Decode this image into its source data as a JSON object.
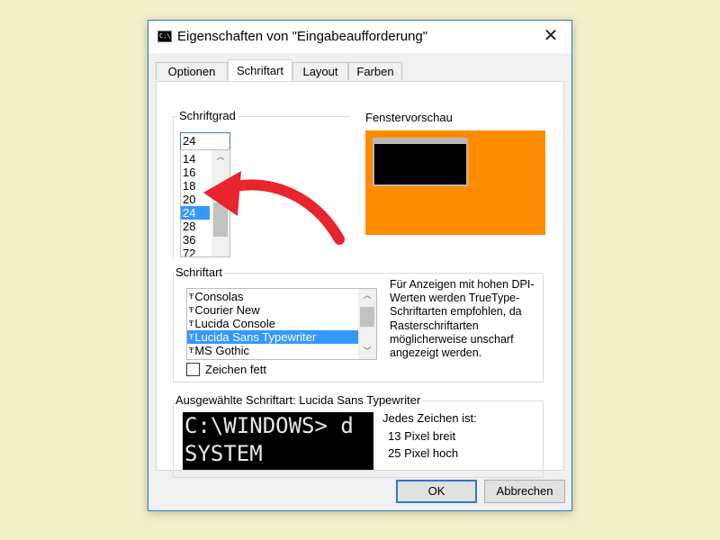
{
  "window": {
    "title": "Eigenschaften von \"Eingabeaufforderung\"",
    "close_symbol": "✕",
    "accent_color": "#2b79d0"
  },
  "tabs": [
    {
      "label": "Optionen",
      "active": false
    },
    {
      "label": "Schriftart",
      "active": true
    },
    {
      "label": "Layout",
      "active": false
    },
    {
      "label": "Farben",
      "active": false
    }
  ],
  "font_size": {
    "group_label": "Schriftgrad",
    "input_value": "24",
    "options": [
      "14",
      "16",
      "18",
      "20",
      "24",
      "28",
      "36",
      "72"
    ],
    "selected": "24"
  },
  "preview": {
    "label": "Fenstervorschau",
    "background_color": "#ff8c00"
  },
  "font": {
    "group_label": "Schriftart",
    "options": [
      "Consolas",
      "Courier New",
      "Lucida Console",
      "Lucida Sans Typewriter",
      "MS Gothic"
    ],
    "selected": "Lucida Sans Typewriter",
    "truetype_glyph": "Ŧ",
    "bold_label": "Zeichen fett",
    "bold_checked": false,
    "info_text": "Für Anzeigen mit hohen DPI-Werten werden TrueType-Schriftarten empfohlen, da Rasterschriftarten möglicherweise unscharf angezeigt werden."
  },
  "selected_font": {
    "group_label": "Ausgewählte Schriftart: Lucida Sans Typewriter",
    "console_line1": "C:\\WINDOWS> d",
    "console_line2": "SYSTEM",
    "char_label": "Jedes Zeichen ist:",
    "width_text": "13 Pixel breit",
    "height_text": "25 Pixel hoch"
  },
  "buttons": {
    "ok": "OK",
    "cancel": "Abbrechen"
  },
  "annotation_color": "#e8242c"
}
